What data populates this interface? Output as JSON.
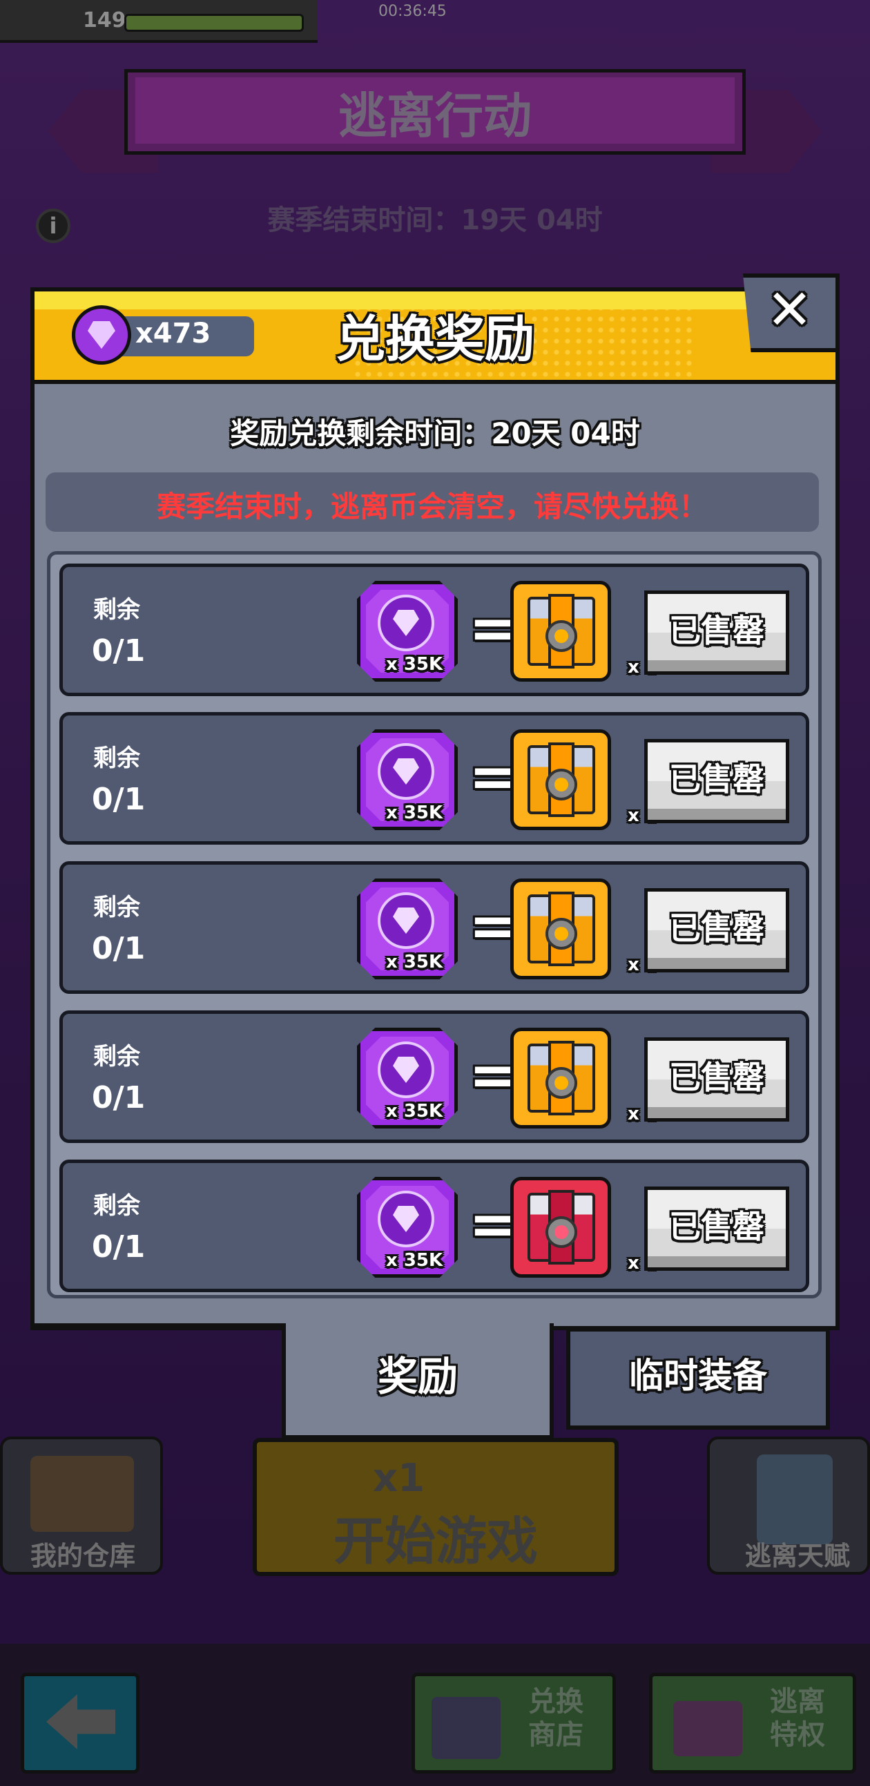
{
  "hud": {
    "level": "149",
    "timer": "00:36:45"
  },
  "event": {
    "title": "逃离行动",
    "season_end": "赛季结束时间：19天 04时",
    "info_icon": "i"
  },
  "modal": {
    "currency_amount": "x473",
    "currency_icon": "purple-gem-coin",
    "title": "兑换奖励",
    "close_label": "✕",
    "countdown": "奖励兑换剩余时间：20天 04时",
    "warning": "赛季结束时，逃离币会清空，请尽快兑换！",
    "warning_color": "#ff3b3b",
    "rows": [
      {
        "label": "剩余",
        "count": "0/1",
        "cost": "x 35K",
        "equals": "=",
        "reward_qty": "x 1",
        "reward_color": "gold",
        "button": "已售罄"
      },
      {
        "label": "剩余",
        "count": "0/1",
        "cost": "x 35K",
        "equals": "=",
        "reward_qty": "x 1",
        "reward_color": "gold",
        "button": "已售罄"
      },
      {
        "label": "剩余",
        "count": "0/1",
        "cost": "x 35K",
        "equals": "=",
        "reward_qty": "x 1",
        "reward_color": "gold",
        "button": "已售罄"
      },
      {
        "label": "剩余",
        "count": "0/1",
        "cost": "x 35K",
        "equals": "=",
        "reward_qty": "x 1",
        "reward_color": "gold",
        "button": "已售罄"
      },
      {
        "label": "剩余",
        "count": "0/1",
        "cost": "x 35K",
        "equals": "=",
        "reward_qty": "x 1",
        "reward_color": "red",
        "button": "已售罄"
      }
    ],
    "tabs": [
      {
        "label": "奖励",
        "active": true
      },
      {
        "label": "临时装备",
        "active": false
      }
    ]
  },
  "bottom_menu": {
    "warehouse": "我的仓库",
    "start_energy": "x1",
    "start": "开始游戏",
    "talent": "逃离天赋",
    "shop": "兑换\n商店",
    "privilege": "逃离\n特权"
  }
}
